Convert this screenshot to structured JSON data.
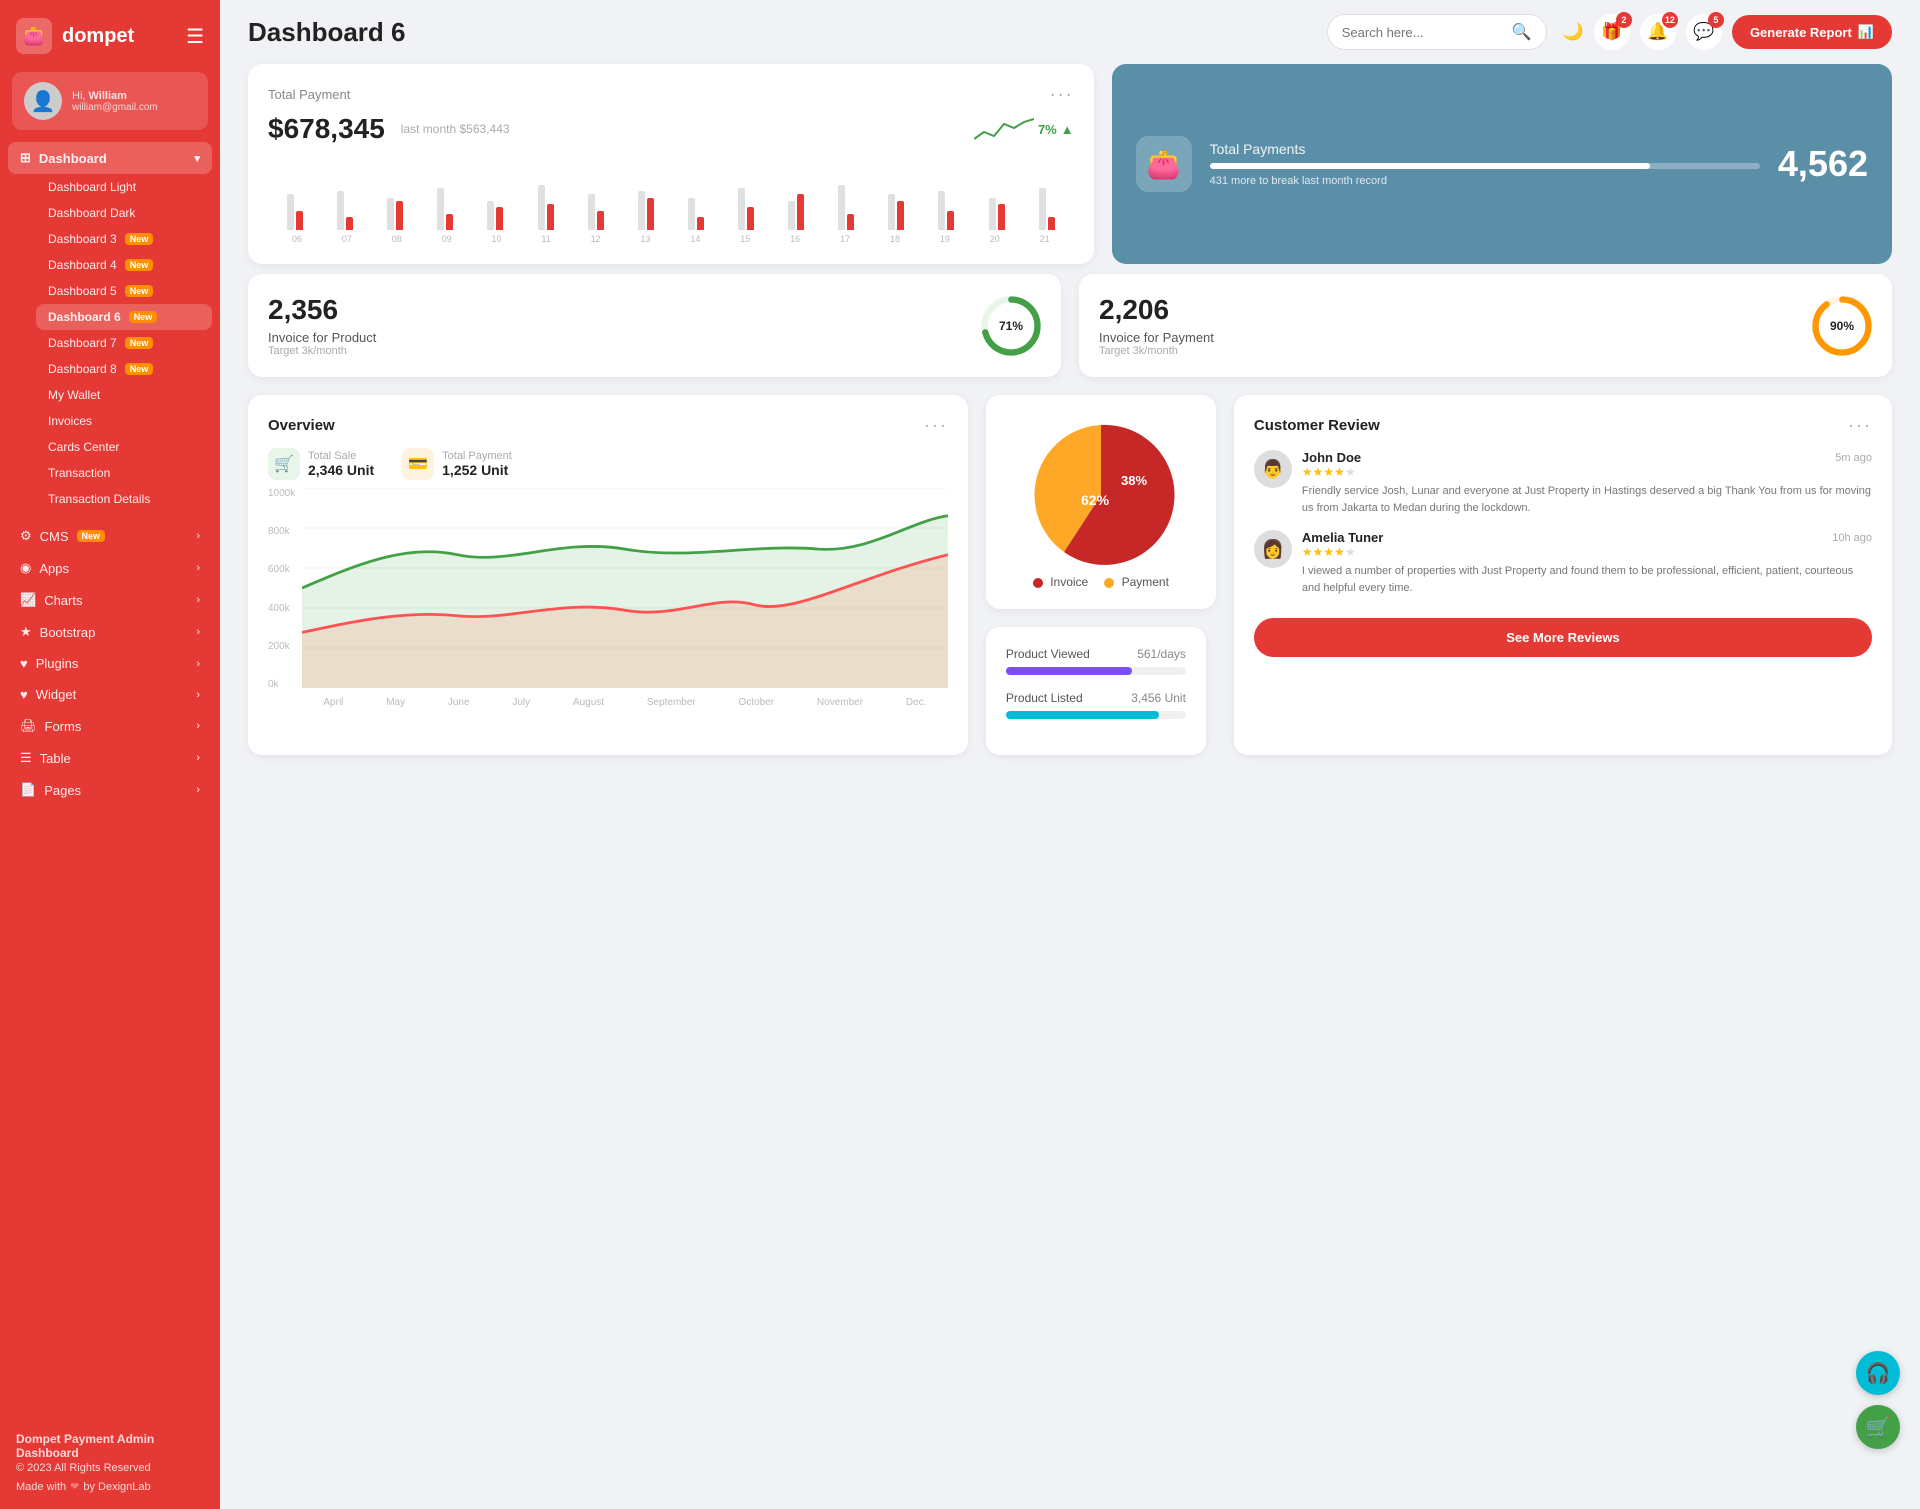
{
  "brand": {
    "name": "dompet",
    "icon": "👛"
  },
  "user": {
    "greeting": "Hi,",
    "name": "William",
    "email": "william@gmail.com",
    "avatar": "👤"
  },
  "sidebar": {
    "dashboard_label": "Dashboard",
    "items": [
      {
        "label": "Dashboard Light",
        "id": "dashboard-light"
      },
      {
        "label": "Dashboard Dark",
        "id": "dashboard-dark"
      },
      {
        "label": "Dashboard 3",
        "id": "dashboard-3",
        "badge": "New"
      },
      {
        "label": "Dashboard 4",
        "id": "dashboard-4",
        "badge": "New"
      },
      {
        "label": "Dashboard 5",
        "id": "dashboard-5",
        "badge": "New"
      },
      {
        "label": "Dashboard 6",
        "id": "dashboard-6",
        "badge": "New",
        "active": true
      },
      {
        "label": "Dashboard 7",
        "id": "dashboard-7",
        "badge": "New"
      },
      {
        "label": "Dashboard 8",
        "id": "dashboard-8",
        "badge": "New"
      },
      {
        "label": "My Wallet",
        "id": "my-wallet"
      },
      {
        "label": "Invoices",
        "id": "invoices"
      },
      {
        "label": "Cards Center",
        "id": "cards-center"
      },
      {
        "label": "Transaction",
        "id": "transaction"
      },
      {
        "label": "Transaction Details",
        "id": "transaction-details"
      }
    ],
    "nav_items": [
      {
        "label": "CMS",
        "id": "cms",
        "badge": "New",
        "has_arrow": true
      },
      {
        "label": "Apps",
        "id": "apps",
        "has_arrow": true
      },
      {
        "label": "Charts",
        "id": "charts",
        "has_arrow": true
      },
      {
        "label": "Bootstrap",
        "id": "bootstrap",
        "has_arrow": true
      },
      {
        "label": "Plugins",
        "id": "plugins",
        "has_arrow": true
      },
      {
        "label": "Widget",
        "id": "widget",
        "has_arrow": true
      },
      {
        "label": "Forms",
        "id": "forms",
        "has_arrow": true
      },
      {
        "label": "Table",
        "id": "table",
        "has_arrow": true
      },
      {
        "label": "Pages",
        "id": "pages",
        "has_arrow": true
      }
    ],
    "footer": {
      "title": "Dompet Payment Admin Dashboard",
      "copyright": "© 2023 All Rights Reserved",
      "made_by": "Made with ❤ by DexignLab"
    }
  },
  "topbar": {
    "page_title": "Dashboard 6",
    "search_placeholder": "Search here...",
    "badge_gift": "2",
    "badge_bell": "12",
    "badge_chat": "5",
    "generate_report": "Generate Report"
  },
  "total_payment": {
    "label": "Total Payment",
    "amount": "$678,345",
    "last_month_label": "last month $563,443",
    "trend_pct": "7%",
    "bars": [
      {
        "gray": 55,
        "red": 30
      },
      {
        "gray": 60,
        "red": 20
      },
      {
        "gray": 50,
        "red": 45
      },
      {
        "gray": 65,
        "red": 25
      },
      {
        "gray": 45,
        "red": 35
      },
      {
        "gray": 70,
        "red": 40
      },
      {
        "gray": 55,
        "red": 30
      },
      {
        "gray": 60,
        "red": 50
      },
      {
        "gray": 50,
        "red": 20
      },
      {
        "gray": 65,
        "red": 35
      },
      {
        "gray": 45,
        "red": 55
      },
      {
        "gray": 70,
        "red": 25
      },
      {
        "gray": 55,
        "red": 45
      },
      {
        "gray": 60,
        "red": 30
      },
      {
        "gray": 50,
        "red": 40
      },
      {
        "gray": 65,
        "red": 20
      }
    ],
    "bar_labels": [
      "06",
      "07",
      "08",
      "09",
      "10",
      "11",
      "12",
      "13",
      "14",
      "15",
      "16",
      "17",
      "18",
      "19",
      "20",
      "21"
    ]
  },
  "total_payments_blue": {
    "title": "Total Payments",
    "sub": "431 more to break last month record",
    "number": "4,562",
    "progress": 80
  },
  "invoice_product": {
    "number": "2,356",
    "label": "Invoice for Product",
    "sub": "Target 3k/month",
    "pct": 71,
    "color": "#43a047"
  },
  "invoice_payment": {
    "number": "2,206",
    "label": "Invoice for Payment",
    "sub": "Target 3k/month",
    "pct": 90,
    "color": "#ff9800"
  },
  "overview": {
    "title": "Overview",
    "total_sale_label": "Total Sale",
    "total_sale_value": "2,346 Unit",
    "total_payment_label": "Total Payment",
    "total_payment_value": "1,252 Unit",
    "x_labels": [
      "April",
      "May",
      "June",
      "July",
      "August",
      "September",
      "October",
      "November",
      "Dec."
    ],
    "y_labels": [
      "1000k",
      "800k",
      "600k",
      "400k",
      "200k",
      "0k"
    ]
  },
  "pie_chart": {
    "invoice_pct": 62,
    "payment_pct": 38,
    "invoice_label": "Invoice",
    "payment_label": "Payment",
    "invoice_color": "#c62828",
    "payment_color": "#ffa726"
  },
  "product_stats": {
    "viewed_label": "Product Viewed",
    "viewed_value": "561/days",
    "viewed_pct": 70,
    "listed_label": "Product Listed",
    "listed_value": "3,456 Unit",
    "listed_pct": 85
  },
  "customer_review": {
    "title": "Customer Review",
    "reviews": [
      {
        "name": "John Doe",
        "time": "5m ago",
        "stars": 4,
        "text": "Friendly service Josh, Lunar and everyone at Just Property in Hastings deserved a big Thank You from us for moving us from Jakarta to Medan during the lockdown.",
        "avatar": "👨"
      },
      {
        "name": "Amelia Tuner",
        "time": "10h ago",
        "stars": 4,
        "text": "I viewed a number of properties with Just Property and found them to be professional, efficient, patient, courteous and helpful every time.",
        "avatar": "👩"
      }
    ],
    "see_more_label": "See More Reviews"
  }
}
